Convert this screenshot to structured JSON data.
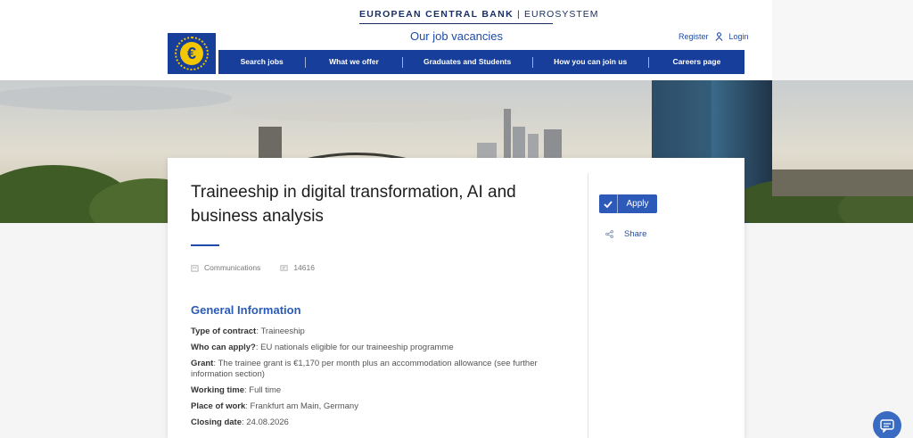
{
  "header": {
    "brand_main": "EUROPEAN CENTRAL BANK",
    "brand_sub": "EUROSYSTEM",
    "subtitle": "Our job vacancies",
    "register": "Register",
    "login": "Login",
    "logo_symbol": "€",
    "accent_color": "#163e9a"
  },
  "nav": {
    "items": [
      "Search jobs",
      "What we offer",
      "Graduates and Students",
      "How you can join us",
      "Careers page"
    ]
  },
  "job": {
    "title": "Traineeship in digital transformation, AI and business analysis",
    "department": "Communications",
    "reference": "14616",
    "apply_label": "Apply",
    "share_label": "Share"
  },
  "general_info": {
    "heading": "General Information",
    "rows": [
      {
        "label": "Type of contract",
        "value": "Traineeship"
      },
      {
        "label": "Who can apply?",
        "value": "EU nationals eligible for our traineeship programme"
      },
      {
        "label": "Grant",
        "value": "The trainee grant is €1,170 per month plus an accommodation allowance (see further information section)"
      },
      {
        "label": "Working time",
        "value": "Full time"
      },
      {
        "label": "Place of work",
        "value": "Frankfurt am Main, Germany"
      },
      {
        "label": "Closing date",
        "value": "24.08.2026"
      }
    ]
  },
  "icons": {
    "department": "building-icon",
    "reference": "id-card-icon",
    "apply": "check-icon",
    "share": "share-icon",
    "user": "user-icon",
    "chat": "chat-icon"
  }
}
